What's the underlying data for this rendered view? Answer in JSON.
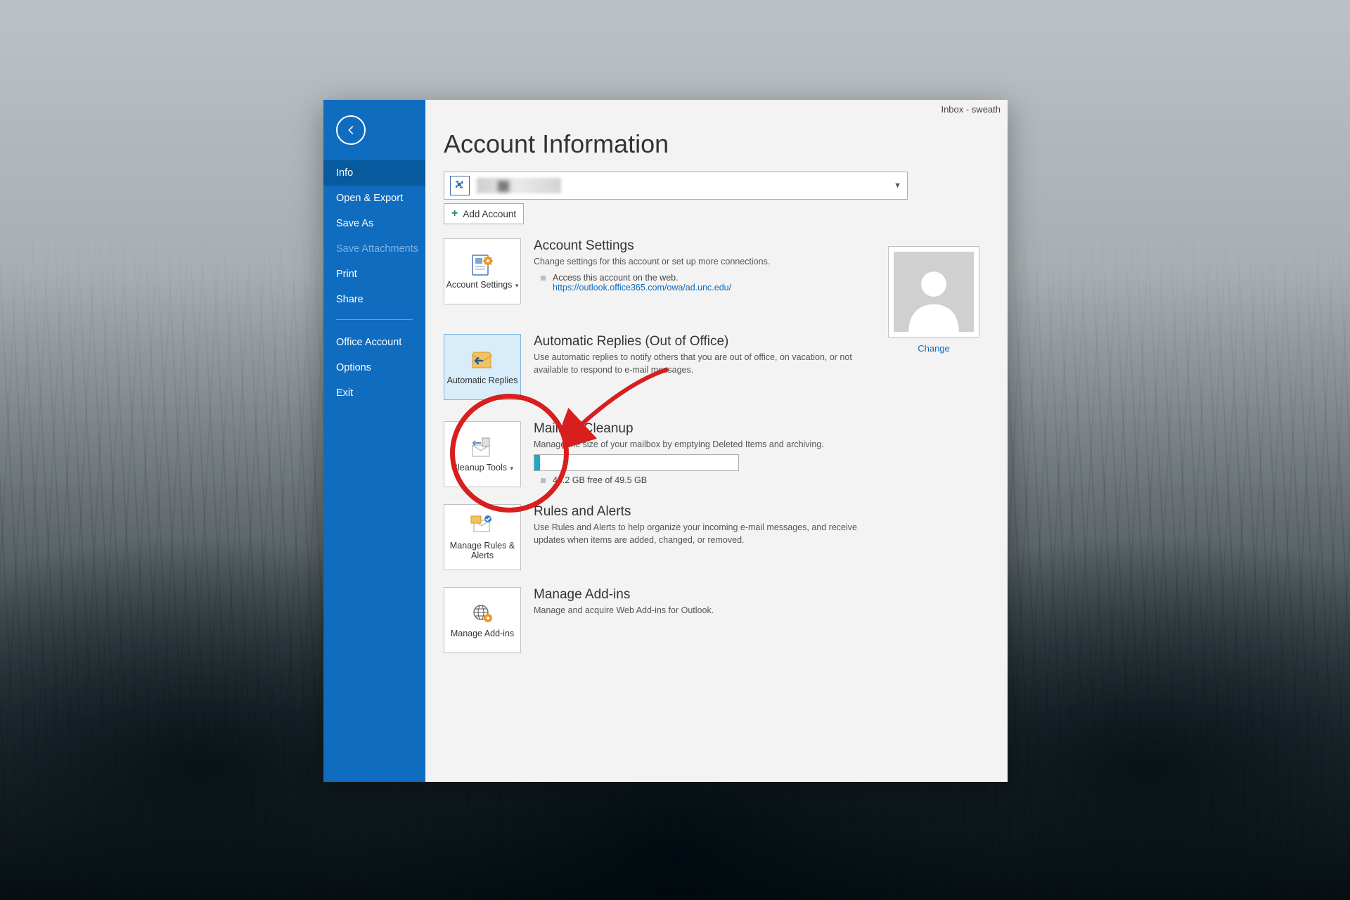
{
  "titlebar": "Inbox - sweath",
  "page_title": "Account Information",
  "sidebar": {
    "items": [
      "Info",
      "Open & Export",
      "Save As",
      "Save Attachments",
      "Print",
      "Share"
    ],
    "items2": [
      "Office Account",
      "Options",
      "Exit"
    ]
  },
  "add_account": "Add Account",
  "avatar_change": "Change",
  "sections": {
    "settings": {
      "btn": "Account Settings",
      "title": "Account Settings",
      "desc": "Change settings for this account or set up more connections.",
      "bullet": "Access this account on the web.",
      "url": "https://outlook.office365.com/owa/ad.unc.edu/"
    },
    "auto": {
      "btn": "Automatic Replies",
      "title": "Automatic Replies (Out of Office)",
      "desc": "Use automatic replies to notify others that you are out of office, on vacation, or not available to respond to e-mail messages."
    },
    "cleanup": {
      "btn": "Cleanup Tools",
      "title": "Mailbox Cleanup",
      "desc": "Manage the size of your mailbox by emptying Deleted Items and archiving.",
      "storage": "48.2 GB free of 49.5 GB"
    },
    "rules": {
      "btn": "Manage Rules & Alerts",
      "title": "Rules and Alerts",
      "desc": "Use Rules and Alerts to help organize your incoming e-mail messages, and receive updates when items are added, changed, or removed."
    },
    "addins": {
      "btn": "Manage Add-ins",
      "title": "Manage Add-ins",
      "desc": "Manage and acquire Web Add-ins for Outlook."
    }
  }
}
